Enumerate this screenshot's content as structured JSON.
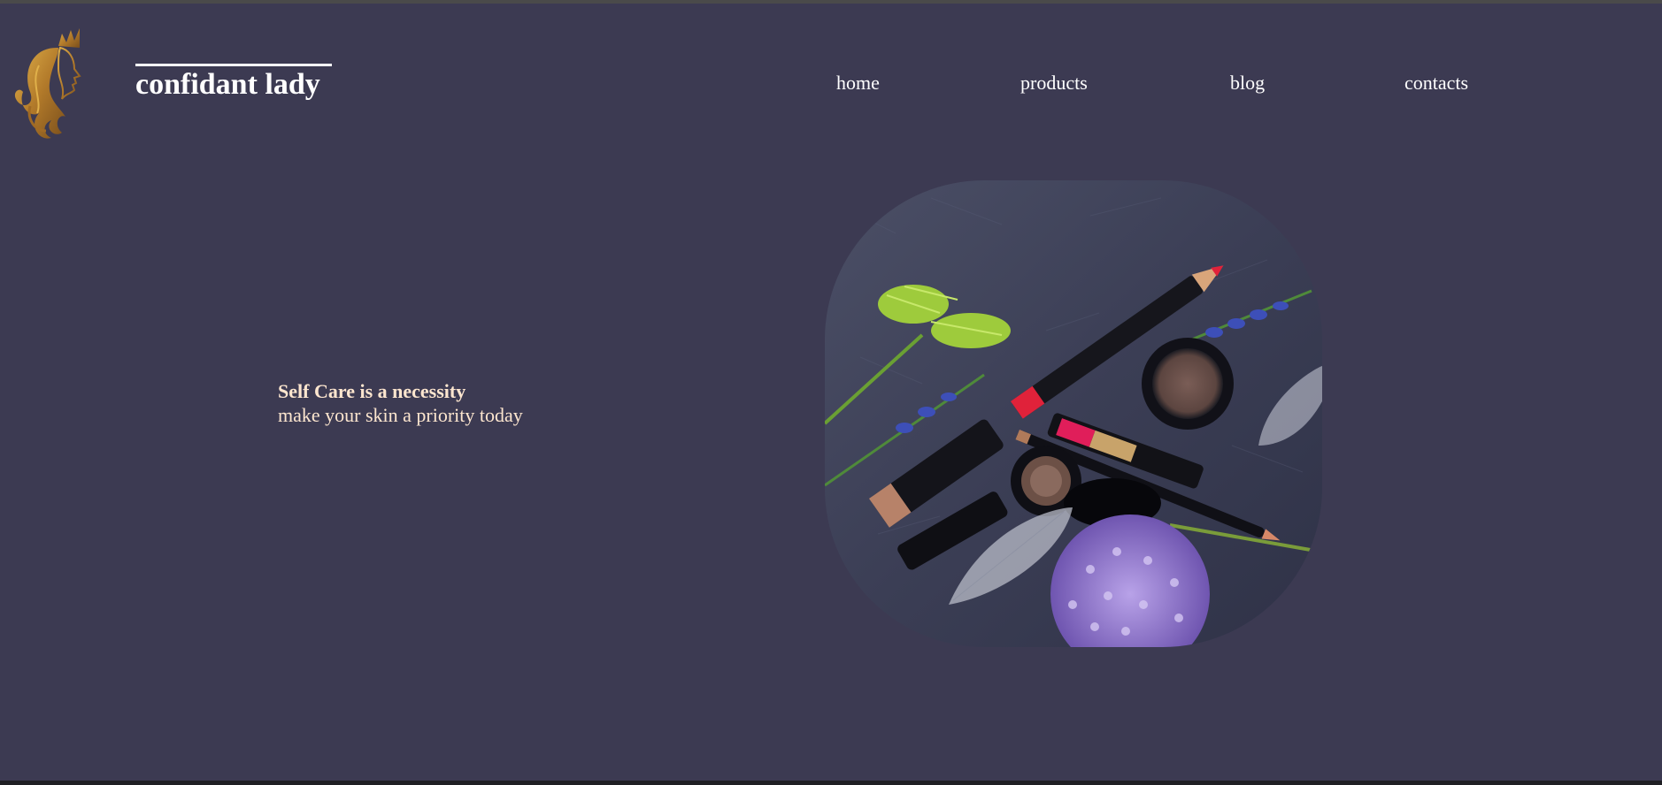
{
  "header": {
    "brand_name": "confidant lady",
    "logo_icon": "crowned-woman-profile-icon",
    "nav": [
      {
        "label": "home"
      },
      {
        "label": "products"
      },
      {
        "label": "blog"
      },
      {
        "label": "contacts"
      }
    ]
  },
  "hero": {
    "title": "Self Care is a necessity",
    "subtitle": "make your skin a priority today",
    "image_subject": "cosmetics-flatlay-image"
  },
  "colors": {
    "background": "#3c3a52",
    "brand_text": "#ffffff",
    "nav_text": "#ffffff",
    "hero_text": "#fde6cf",
    "logo_gold": "#c9912f"
  }
}
